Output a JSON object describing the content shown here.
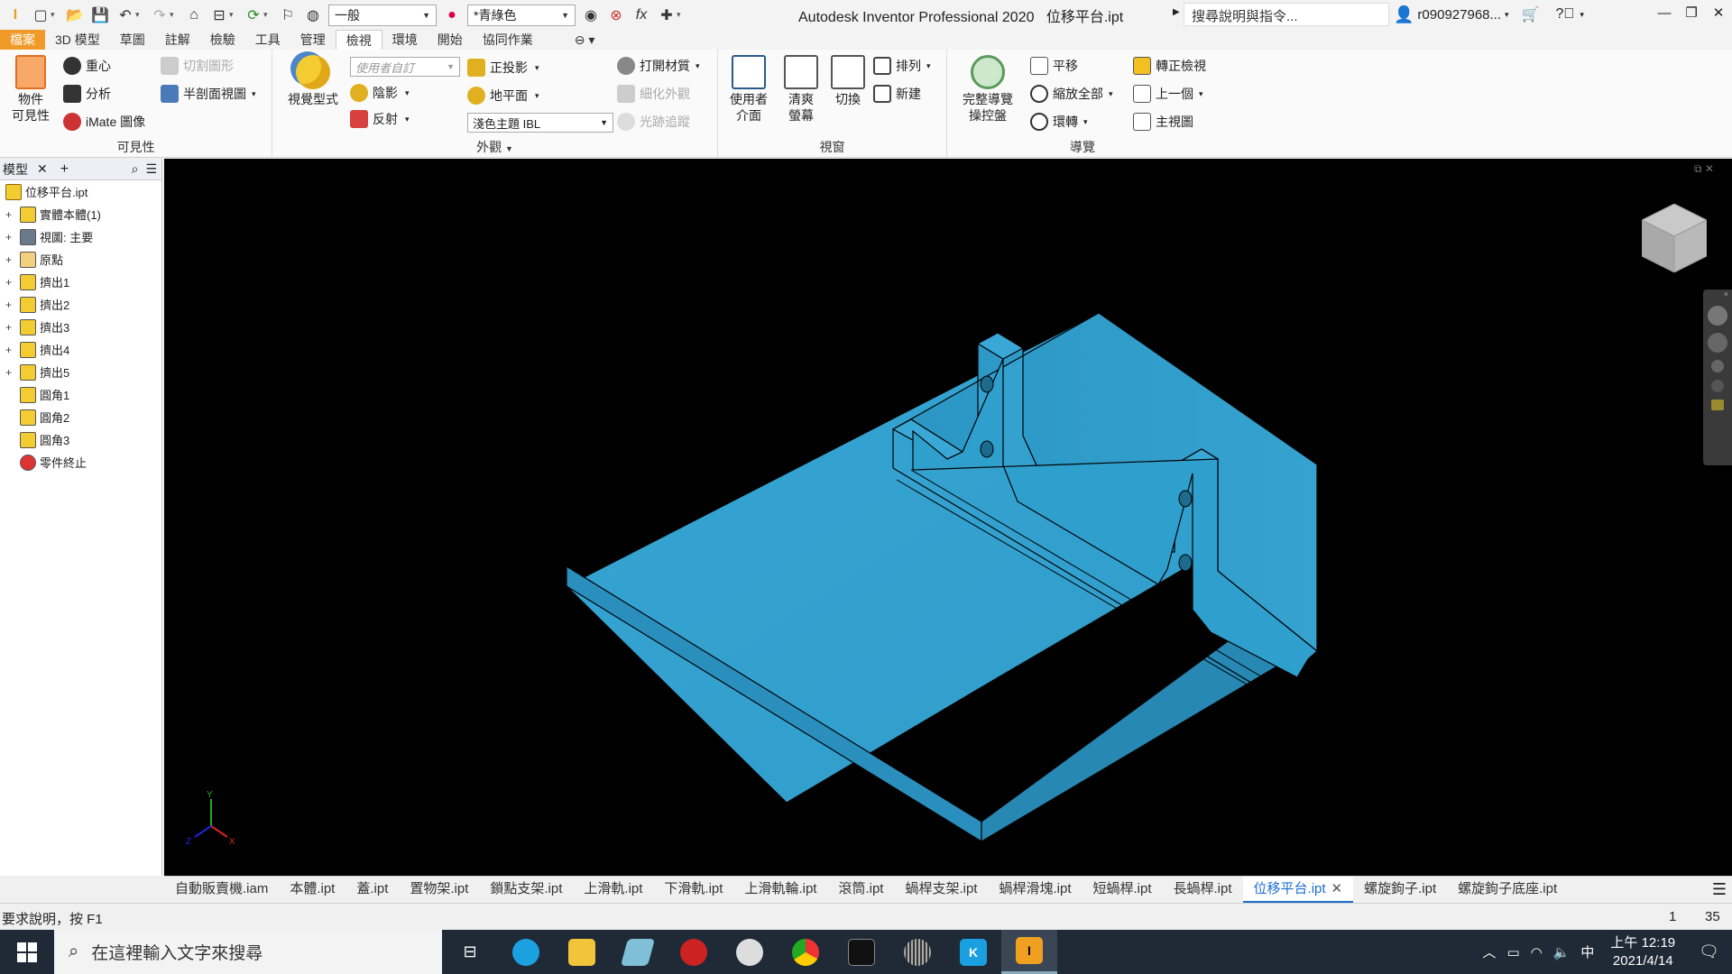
{
  "app": {
    "title": "Autodesk Inventor Professional 2020",
    "file": "位移平台.ipt",
    "help_search": "搜尋說明與指令...",
    "user": "r090927968...",
    "style_combo": "一般",
    "color_combo": "*青綠色"
  },
  "ribbon_tabs": [
    "檔案",
    "3D 模型",
    "草圖",
    "註解",
    "檢驗",
    "工具",
    "管理",
    "檢視",
    "環境",
    "開始",
    "協同作業"
  ],
  "ribbon": {
    "visibility": {
      "title": "可見性",
      "object_visibility": "物件\n可見性",
      "center_of_gravity": "重心",
      "analysis": "分析",
      "imate": "iMate 圖像",
      "section_cut": "切割圖形",
      "half_section": "半剖面視圖"
    },
    "appearance": {
      "title": "外觀",
      "visual_style": "視覺型式",
      "user_defined": "使用者自訂",
      "shadow": "陰影",
      "reflection": "反射",
      "orthographic": "正投影",
      "ground_plane": "地平面",
      "ibl": "淺色主題 IBL",
      "open_material": "打開材質",
      "refine_appearance": "細化外觀",
      "ray_tracing": "光跡追蹤"
    },
    "windows": {
      "title": "視窗",
      "user_interface": "使用者\n介面",
      "clean_screen": "清爽\n螢幕",
      "switch": "切換",
      "arrange": "排列",
      "new": "新建"
    },
    "navigate": {
      "title": "導覽",
      "full_nav_wheel": "完整導覽\n操控盤",
      "pan": "平移",
      "zoom_all": "縮放全部",
      "orbit": "環轉",
      "look_at": "轉正檢視",
      "previous": "上一個",
      "home_view": "主視圖"
    }
  },
  "browser": {
    "title": "模型",
    "root": "位移平台.ipt",
    "items": [
      {
        "label": "實體本體(1)",
        "expand": true,
        "icon": "solid-bodies-icon"
      },
      {
        "label": "視圖: 主要",
        "expand": true,
        "icon": "view-icon"
      },
      {
        "label": "原點",
        "expand": true,
        "icon": "origin-folder-icon"
      },
      {
        "label": "擠出1",
        "expand": true,
        "icon": "extrude-icon"
      },
      {
        "label": "擠出2",
        "expand": true,
        "icon": "extrude-icon"
      },
      {
        "label": "擠出3",
        "expand": true,
        "icon": "extrude-icon"
      },
      {
        "label": "擠出4",
        "expand": true,
        "icon": "extrude-icon"
      },
      {
        "label": "擠出5",
        "expand": true,
        "icon": "extrude-icon"
      },
      {
        "label": "圓角1",
        "expand": false,
        "icon": "fillet-icon"
      },
      {
        "label": "圓角2",
        "expand": false,
        "icon": "fillet-icon"
      },
      {
        "label": "圓角3",
        "expand": false,
        "icon": "fillet-icon"
      },
      {
        "label": "零件終止",
        "expand": false,
        "icon": "end-of-part-icon"
      }
    ]
  },
  "doc_tabs": [
    "自動販賣機.iam",
    "本體.ipt",
    "蓋.ipt",
    "置物架.ipt",
    "鎖點支架.ipt",
    "上滑軌.ipt",
    "下滑軌.ipt",
    "上滑軌輪.ipt",
    "滾筒.ipt",
    "蝸桿支架.ipt",
    "蝸桿滑塊.ipt",
    "短蝸桿.ipt",
    "長蝸桿.ipt",
    "位移平台.ipt",
    "螺旋鉤子.ipt",
    "螺旋鉤子底座.ipt"
  ],
  "active_doc": "位移平台.ipt",
  "status": {
    "text": "要求說明，按 F1",
    "n1": "1",
    "n2": "35"
  },
  "taskbar": {
    "search_placeholder": "在這裡輸入文字來搜尋",
    "time": "上午 12:19",
    "date": "2021/4/14",
    "ime": "中"
  },
  "colors": {
    "part": "#2e9ccb",
    "viewport_bg": "#000000",
    "file_tab": "#f09a2a",
    "active_tab": "#1c6ed1"
  }
}
